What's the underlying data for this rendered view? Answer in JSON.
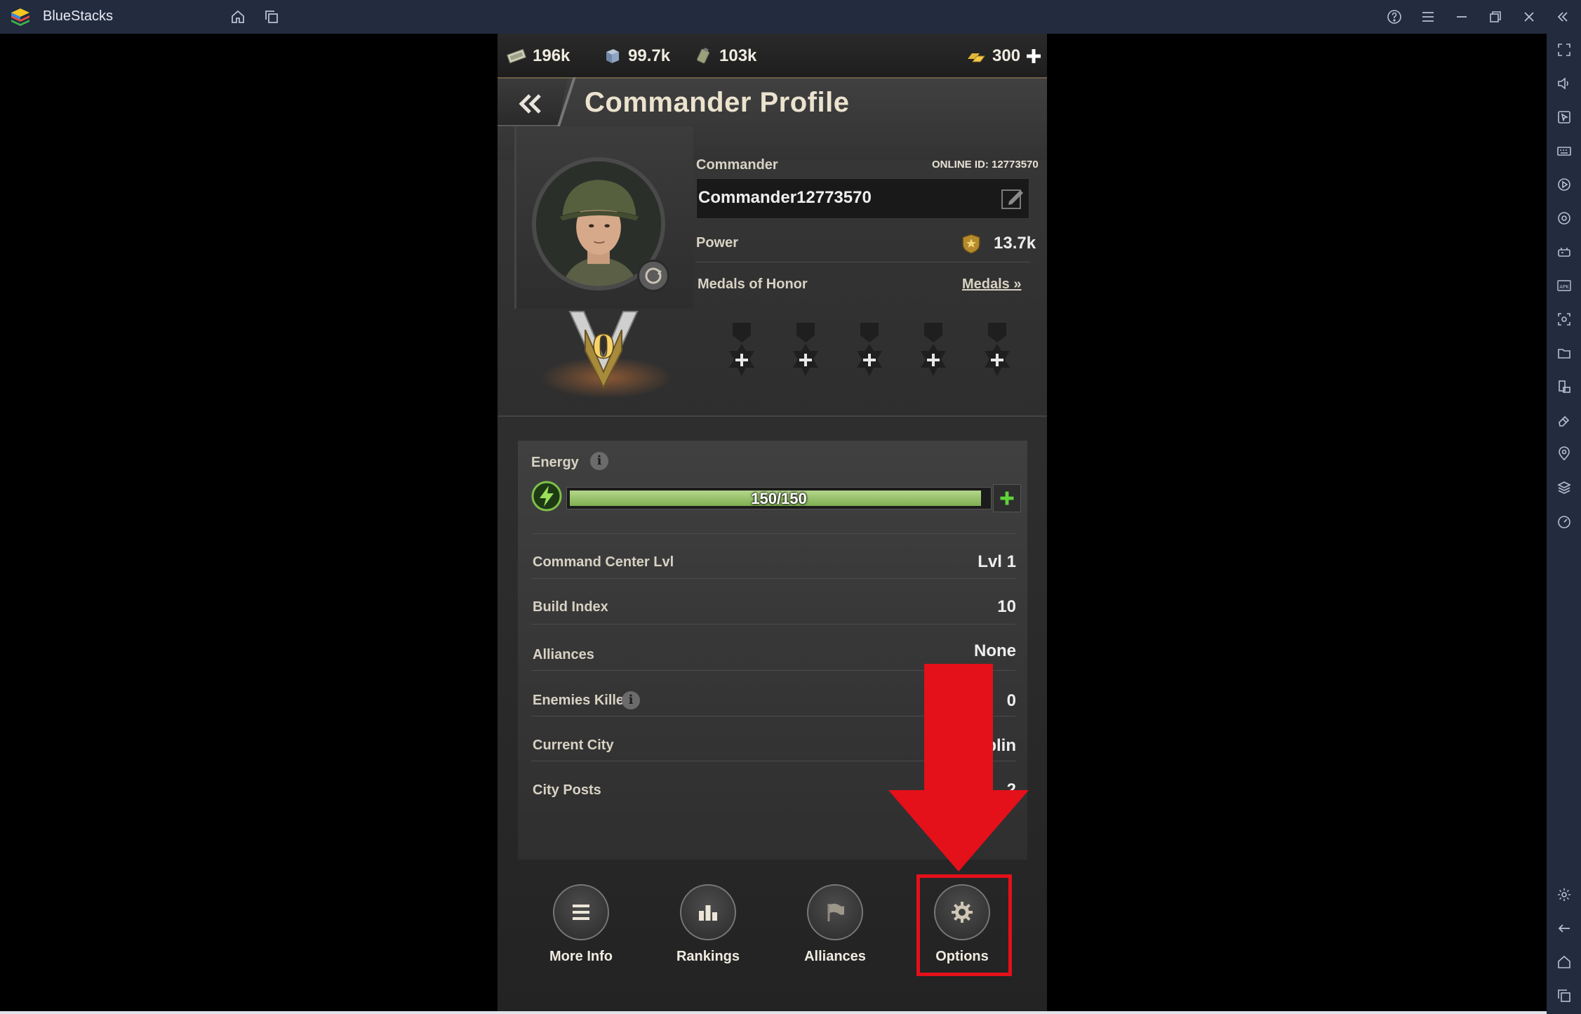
{
  "app": {
    "title": "BlueStacks"
  },
  "resources": [
    {
      "name": "cash",
      "value": "196k"
    },
    {
      "name": "steel",
      "value": "99.7k"
    },
    {
      "name": "oil",
      "value": "103k"
    },
    {
      "name": "gold",
      "value": "300"
    }
  ],
  "header": {
    "title": "Commander Profile"
  },
  "profile": {
    "commander_label": "Commander",
    "online_id": "ONLINE ID: 12773570",
    "name": "Commander12773570",
    "power_label": "Power",
    "power_value": "13.7k",
    "medals_label": "Medals of Honor",
    "medals_link": "Medals",
    "rank_numeral": "0"
  },
  "energy": {
    "label": "Energy",
    "text": "150/150",
    "fraction": 1.0
  },
  "stats": [
    {
      "label": "Command Center Lvl",
      "value": "Lvl 1"
    },
    {
      "label": "Build Index",
      "value": "10"
    },
    {
      "label": "Alliances",
      "value": "None"
    },
    {
      "label": "Enemies Killed",
      "value": "0"
    },
    {
      "label": "Current City",
      "value": "blin"
    },
    {
      "label": "City Posts",
      "value": "2"
    }
  ],
  "nav": [
    {
      "label": "More Info",
      "icon": "menu-icon"
    },
    {
      "label": "Rankings",
      "icon": "bar-chart-icon"
    },
    {
      "label": "Alliances",
      "icon": "flag-icon"
    },
    {
      "label": "Options",
      "icon": "gear-icon"
    }
  ],
  "colors": {
    "titlebar": "#232b3f",
    "accent_red": "#e4101a",
    "energy_green": "#9cc770"
  }
}
